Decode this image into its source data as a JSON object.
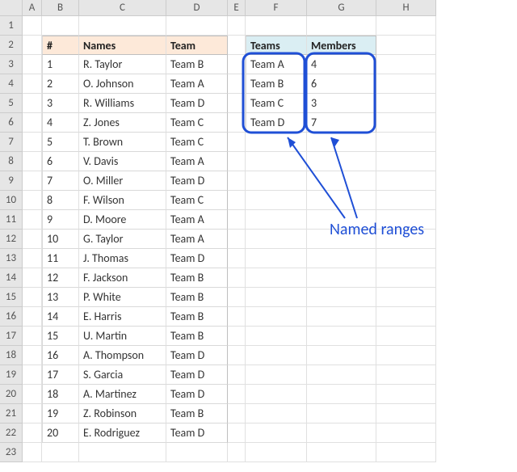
{
  "columns": [
    "A",
    "B",
    "C",
    "D",
    "E",
    "F",
    "G",
    "H"
  ],
  "row_count": 23,
  "main_table": {
    "headers": {
      "num": "#",
      "names": "Names",
      "team": "Team"
    },
    "rows": [
      {
        "n": "1",
        "name": "R. Taylor",
        "team": "Team B"
      },
      {
        "n": "2",
        "name": "O. Johnson",
        "team": "Team A"
      },
      {
        "n": "3",
        "name": "R. Williams",
        "team": "Team D"
      },
      {
        "n": "4",
        "name": "Z. Jones",
        "team": "Team C"
      },
      {
        "n": "5",
        "name": "T. Brown",
        "team": "Team C"
      },
      {
        "n": "6",
        "name": "V. Davis",
        "team": "Team A"
      },
      {
        "n": "7",
        "name": "O. Miller",
        "team": "Team D"
      },
      {
        "n": "8",
        "name": "F. Wilson",
        "team": "Team C"
      },
      {
        "n": "9",
        "name": "D. Moore",
        "team": "Team A"
      },
      {
        "n": "10",
        "name": "G. Taylor",
        "team": "Team A"
      },
      {
        "n": "11",
        "name": "J. Thomas",
        "team": "Team D"
      },
      {
        "n": "12",
        "name": "F. Jackson",
        "team": "Team B"
      },
      {
        "n": "13",
        "name": "P. White",
        "team": "Team B"
      },
      {
        "n": "14",
        "name": "E. Harris",
        "team": "Team B"
      },
      {
        "n": "15",
        "name": "U. Martin",
        "team": "Team B"
      },
      {
        "n": "16",
        "name": "A. Thompson",
        "team": "Team D"
      },
      {
        "n": "17",
        "name": "S. Garcia",
        "team": "Team D"
      },
      {
        "n": "18",
        "name": "A. Martinez",
        "team": "Team D"
      },
      {
        "n": "19",
        "name": "Z. Robinson",
        "team": "Team B"
      },
      {
        "n": "20",
        "name": "E. Rodriguez",
        "team": "Team D"
      }
    ]
  },
  "side_table": {
    "headers": {
      "teams": "Teams",
      "members": "Members"
    },
    "rows": [
      {
        "team": "Team A",
        "members": "4"
      },
      {
        "team": "Team B",
        "members": "6"
      },
      {
        "team": "Team C",
        "members": "3"
      },
      {
        "team": "Team D",
        "members": "7"
      }
    ]
  },
  "annotation": {
    "label": "Named ranges"
  }
}
